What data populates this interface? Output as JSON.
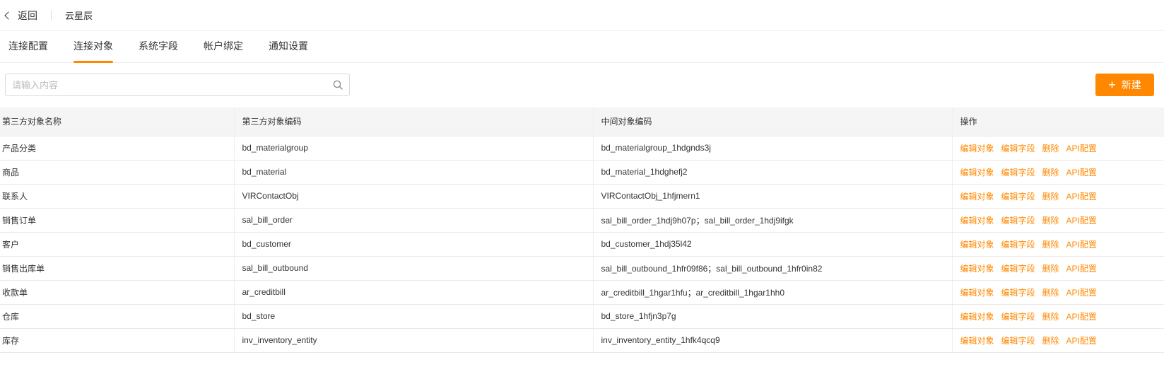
{
  "header": {
    "back_label": "返回",
    "app_name": "云星辰"
  },
  "tabs": [
    {
      "label": "连接配置",
      "active": false
    },
    {
      "label": "连接对象",
      "active": true
    },
    {
      "label": "系统字段",
      "active": false
    },
    {
      "label": "帐户绑定",
      "active": false
    },
    {
      "label": "通知设置",
      "active": false
    }
  ],
  "search": {
    "placeholder": "请输入内容",
    "value": ""
  },
  "toolbar": {
    "new_label": "新建",
    "new_icon": "plus-icon"
  },
  "table": {
    "columns": [
      "第三方对象名称",
      "第三方对象编码",
      "中间对象编码",
      "操作"
    ],
    "actions": [
      "编辑对象",
      "编辑字段",
      "删除",
      "API配置"
    ],
    "rows": [
      {
        "name": "产品分类",
        "code": "bd_materialgroup",
        "mid": "bd_materialgroup_1hdgnds3j"
      },
      {
        "name": "商品",
        "code": "bd_material",
        "mid": "bd_material_1hdghefj2"
      },
      {
        "name": "联系人",
        "code": "VIRContactObj",
        "mid": "VIRContactObj_1hfjmern1"
      },
      {
        "name": "销售订单",
        "code": "sal_bill_order",
        "mid": "sal_bill_order_1hdj9h07p；sal_bill_order_1hdj9ifgk"
      },
      {
        "name": "客户",
        "code": "bd_customer",
        "mid": "bd_customer_1hdj35l42"
      },
      {
        "name": "销售出库单",
        "code": "sal_bill_outbound",
        "mid": "sal_bill_outbound_1hfr09f86；sal_bill_outbound_1hfr0in82"
      },
      {
        "name": "收款单",
        "code": "ar_creditbill",
        "mid": "ar_creditbill_1hgar1hfu；ar_creditbill_1hgar1hh0"
      },
      {
        "name": "仓库",
        "code": "bd_store",
        "mid": "bd_store_1hfjn3p7g"
      },
      {
        "name": "库存",
        "code": "inv_inventory_entity",
        "mid": "inv_inventory_entity_1hfk4qcq9"
      }
    ]
  },
  "colors": {
    "accent": "#ff8800",
    "header_bg": "#f5f5f6",
    "border": "#e8e8e8"
  }
}
